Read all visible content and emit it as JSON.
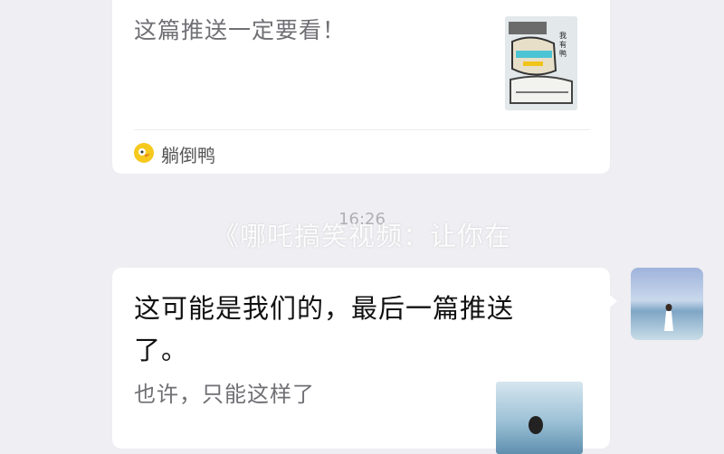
{
  "card_top": {
    "subtitle": "这篇推送一定要看！",
    "source_name": "躺倒鸭"
  },
  "timestamp": "16:26",
  "watermark": "《哪吒搞笑视频：让你在",
  "card_bottom": {
    "title_line1": "这可能是我们的，最后一篇推送",
    "title_line2": "了。",
    "subtitle": "也许，只能这样了"
  },
  "colors": {
    "background": "#efeef2",
    "card": "#ffffff",
    "source_icon": "#f6c91e"
  },
  "icons": [
    "duck-icon",
    "article-thumbnail",
    "user-avatar"
  ]
}
